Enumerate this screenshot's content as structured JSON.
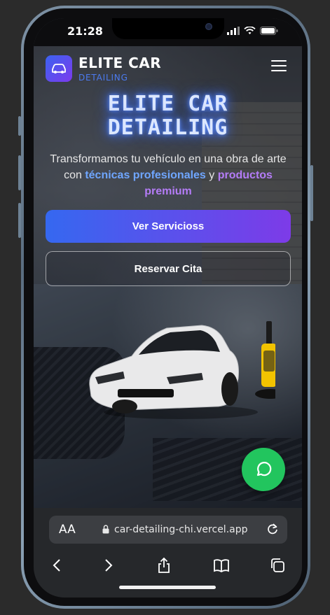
{
  "status_bar": {
    "time": "21:28"
  },
  "header": {
    "brand_name": "ELITE CAR",
    "brand_sub": "DETAILING",
    "logo_icon": "car-icon",
    "menu_icon": "hamburger-menu-icon"
  },
  "hero": {
    "title_line1": "ELITE CAR",
    "title_line2": "DETAILING",
    "text_part1": "Transformamos tu vehículo en una obra de arte con ",
    "highlight_blue": "técnicas profesionales",
    "text_part2": " y ",
    "highlight_purple": "productos premium",
    "primary_button": "Ver Servicioss",
    "secondary_button": "Reservar Cita"
  },
  "fab": {
    "icon": "whatsapp-chat-icon",
    "color": "#22c55e"
  },
  "browser": {
    "aa_label": "AA",
    "url": "car-detailing-chi.vercel.app",
    "nav": [
      "back-icon",
      "forward-icon",
      "share-icon",
      "bookmarks-icon",
      "tabs-icon"
    ]
  },
  "colors": {
    "accent_blue": "#3568f0",
    "accent_purple": "#7d3be8",
    "highlight_blue": "#6fa6ff",
    "highlight_purple": "#b47cf7"
  }
}
